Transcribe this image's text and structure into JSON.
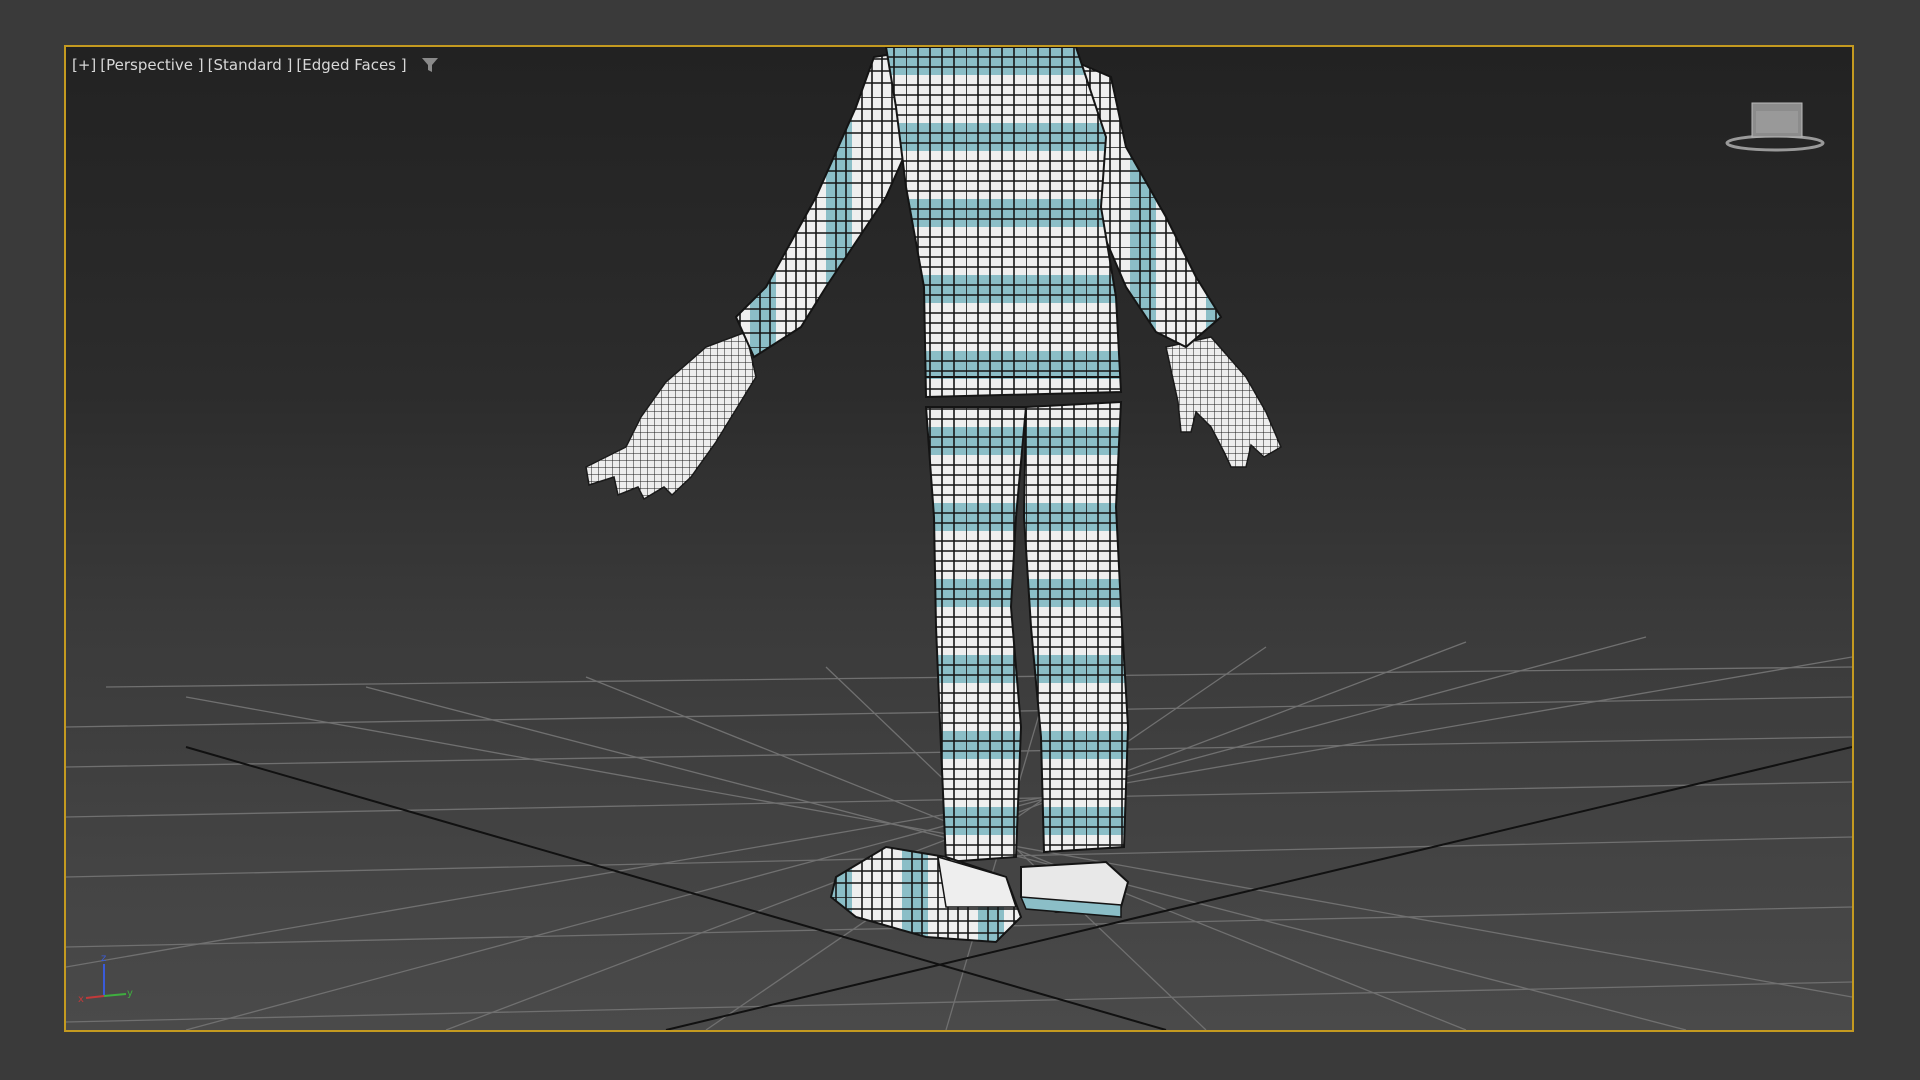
{
  "viewport": {
    "labels": {
      "plus": "[+]",
      "view": "[Perspective ]",
      "shading": "[Standard ]",
      "edges": "[Edged Faces ]"
    },
    "filter_icon": "filter-icon",
    "viewcube_icon": "viewcube-icon",
    "axis_labels": {
      "z": "z",
      "x": "x",
      "y": "y"
    }
  },
  "colors": {
    "viewport_border": "#c49a20",
    "stripe": "#8bbec7",
    "mesh_white": "#eeeeee",
    "wire": "#111111",
    "grid": "#6a6a6a"
  }
}
